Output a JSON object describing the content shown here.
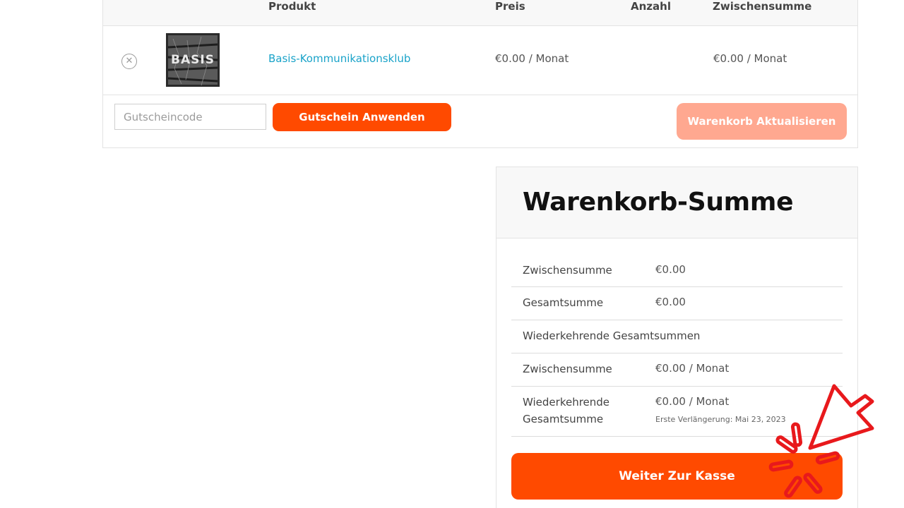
{
  "cart": {
    "headers": {
      "product": "Produkt",
      "price": "Preis",
      "quantity": "Anzahl",
      "subtotal": "Zwischensumme"
    },
    "items": [
      {
        "remove_icon": "close-circle-icon",
        "thumbnail_text": "BASIS",
        "name": "Basis-Kommunikationsklub",
        "price": "€0.00 / Monat",
        "subtotal": "€0.00 / Monat"
      }
    ],
    "coupon_placeholder": "Gutscheincode",
    "apply_coupon_label": "Gutschein Anwenden",
    "update_cart_label": "Warenkorb Aktualisieren"
  },
  "totals": {
    "title": "Warenkorb-Summe",
    "rows": [
      {
        "label": "Zwischensumme",
        "value": "€0.00"
      },
      {
        "label": "Gesamtsumme",
        "value": "€0.00"
      },
      {
        "label": "Wiederkehrende Gesamtsummen"
      },
      {
        "label": "Zwischensumme",
        "value": "€0.00 / Monat"
      },
      {
        "label": "Wiederkehrende Gesamtsumme",
        "value": "€0.00 / Monat",
        "note": "Erste Verlängerung: Mai 23, 2023"
      }
    ],
    "checkout_label": "Weiter Zur Kasse"
  },
  "colors": {
    "accent": "#ff4a00",
    "accent_disabled": "#ffa890",
    "link": "#1aa3c9",
    "pointer": "#e8191c"
  },
  "overlay": {
    "icon": "click-pointer-icon"
  }
}
